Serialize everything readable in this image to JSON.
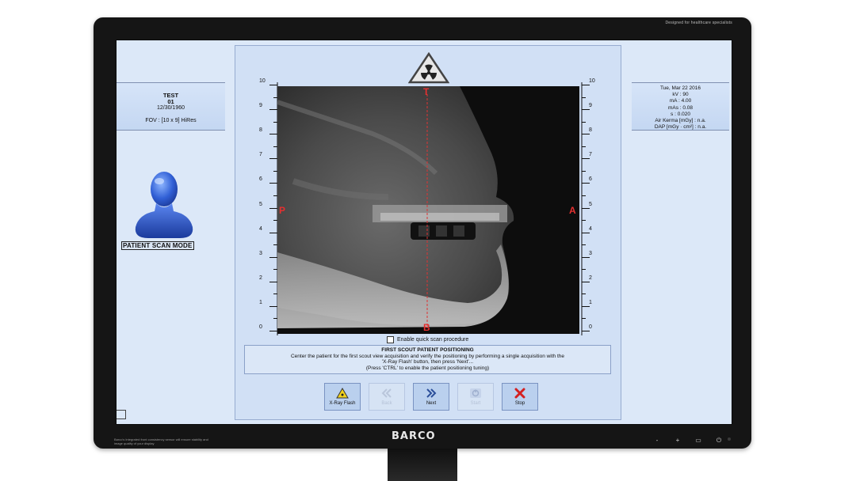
{
  "monitor": {
    "brand": "BARCO",
    "tagline": "Designed for healthcare specialists",
    "bezel_note": "Barco's Integrated front consistency sensor will ensure stability and image quality of your display",
    "controls": [
      "-",
      "+",
      "▭",
      "⏻"
    ]
  },
  "patient": {
    "name": "TEST",
    "id": "01",
    "dob": "12/30/1960",
    "fov": "FOV : [10 x 9] HiRes"
  },
  "acquisition": {
    "date": "Tue, Mar 22 2016",
    "kv": "kV : 90",
    "ma": "mA : 4.00",
    "mas": "mAs : 0.08",
    "s": "s : 0.020",
    "air_kerma": "Air Kerma [mGy] : n.a.",
    "dap": "DAP [mGy · cm²] : n.a."
  },
  "mode_label": "PATIENT SCAN MODE",
  "ruler_ticks": [
    "10",
    "9",
    "8",
    "7",
    "6",
    "5",
    "4",
    "3",
    "2",
    "1",
    "0"
  ],
  "xray_markers": {
    "top": "T",
    "bottom": "B",
    "left": "P",
    "right": "A"
  },
  "quick_scan_label": "Enable quick scan procedure",
  "instruction": {
    "title": "FIRST SCOUT PATIENT POSITIONING",
    "line1": "Center the patient for the first scout view acquisition and verify the positioning by performing a single acquisition with the",
    "line2": "'X-Ray Flash' button, then press 'Next'...",
    "line3": "(Press 'CTRL' to enable the patient positioning tuning)"
  },
  "buttons": {
    "xray_flash": "X-Ray Flash",
    "back": "Back",
    "next": "Next",
    "start": "Start",
    "stop": "Stop"
  },
  "colors": {
    "screen_bg": "#dce8f8",
    "marker_red": "#e53030",
    "button_bg": "#bad0ee",
    "stop_red": "#d42020"
  }
}
